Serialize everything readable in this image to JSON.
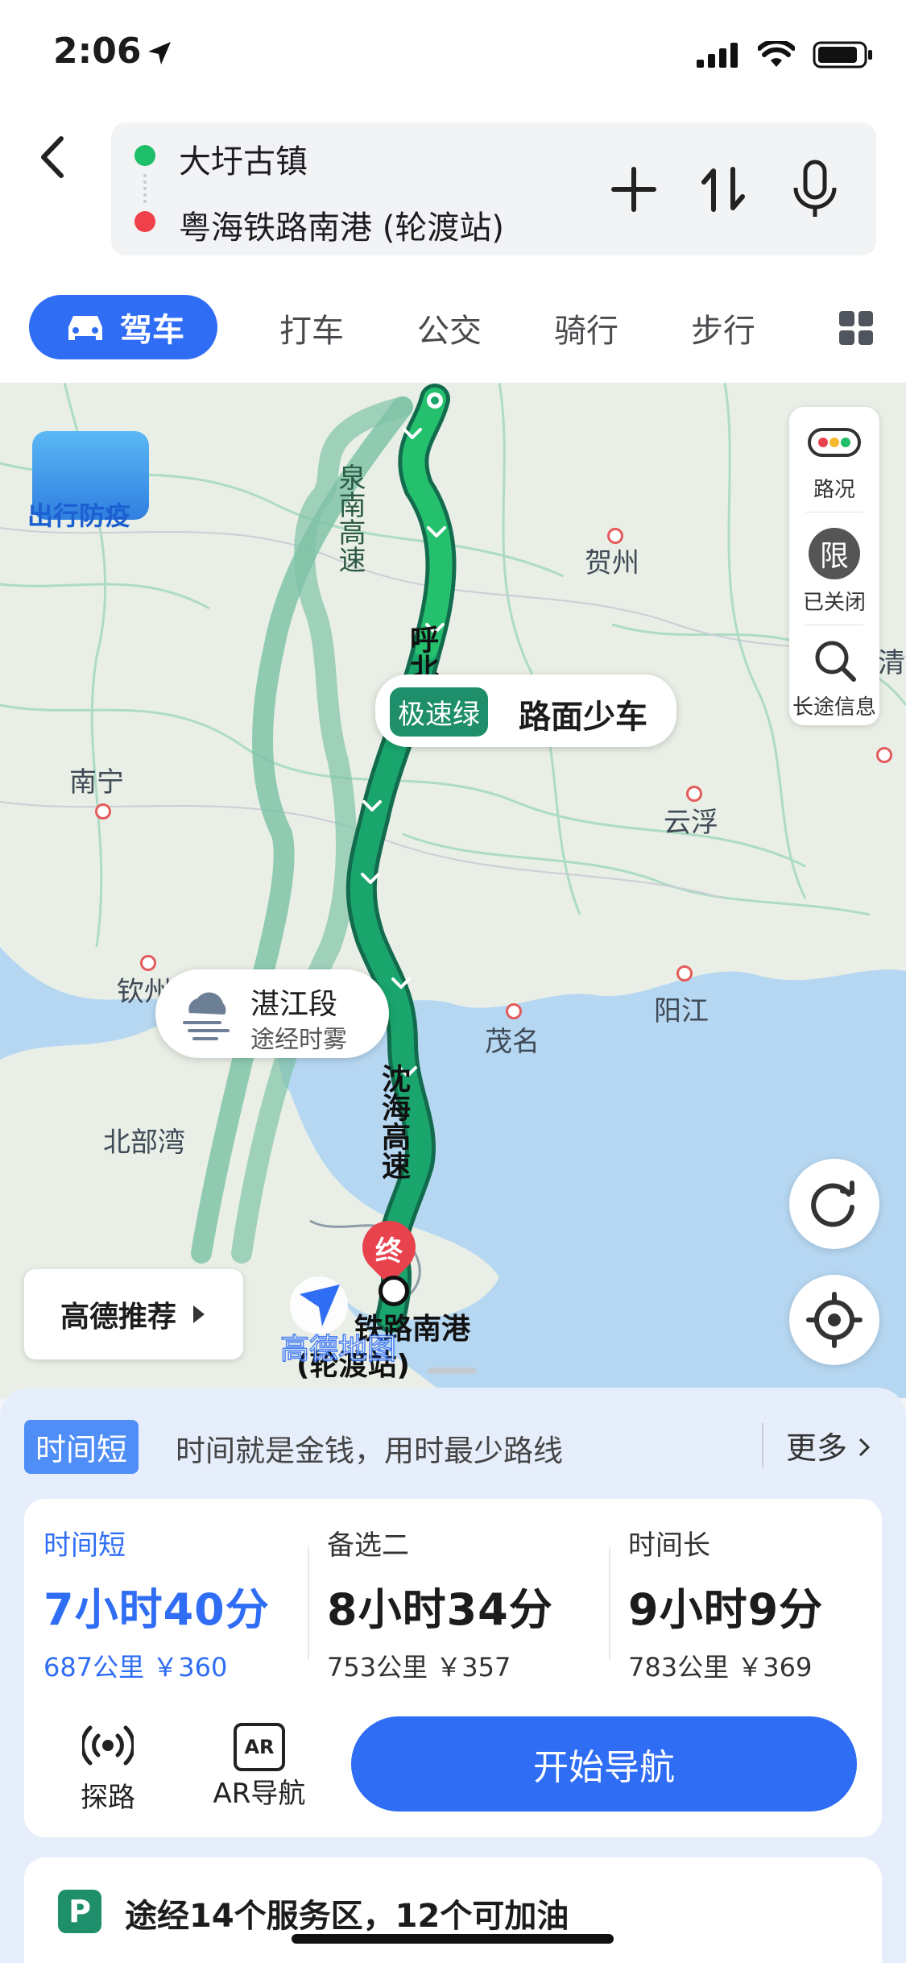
{
  "status_bar": {
    "time": "2:06"
  },
  "route": {
    "origin": "大圩古镇",
    "destination": "粤海铁路南港 (轮渡站)"
  },
  "tabs": {
    "active": "驾车",
    "others": [
      "打车",
      "公交",
      "骑行",
      "步行"
    ]
  },
  "map": {
    "badge_label": "出行防疫",
    "side_panel": {
      "traffic": "路况",
      "limit_glyph": "限",
      "limit": "已关闭",
      "long_trip": "长途信息"
    },
    "cities": [
      "贺州",
      "南宁",
      "云浮",
      "钦州",
      "茂名",
      "阳江",
      "北部湾"
    ],
    "road_labels": {
      "quannan": "泉南高速",
      "hubei": "呼北高速",
      "shenhai": "沈海高速"
    },
    "speed_callout": {
      "badge": "极速绿",
      "text": "路面少车"
    },
    "weather_callout": {
      "title": "湛江段",
      "subtitle": "途经时雾"
    },
    "end_marker": "终",
    "end_label_1": "铁路南港",
    "end_label_2": "(轮渡站)",
    "watermark": "高德地图",
    "recommend_btn": "高德推荐",
    "edge_text": "清"
  },
  "summary": {
    "tag": "时间短",
    "desc": "时间就是金钱，用时最少路线",
    "more": "更多"
  },
  "options": [
    {
      "label": "时间短",
      "duration": "7小时40分",
      "meta": "687公里 ￥360",
      "selected": true
    },
    {
      "label": "备选二",
      "duration": "8小时34分",
      "meta": "753公里 ￥357",
      "selected": false
    },
    {
      "label": "时间长",
      "duration": "9小时9分",
      "meta": "783公里 ￥369",
      "selected": false
    }
  ],
  "tools": {
    "probe": "探路",
    "ar": "AR导航",
    "ar_glyph": "AR"
  },
  "start_button": "开始导航",
  "services": {
    "p_icon": "P",
    "text": "途经14个服务区，12个可加油"
  }
}
